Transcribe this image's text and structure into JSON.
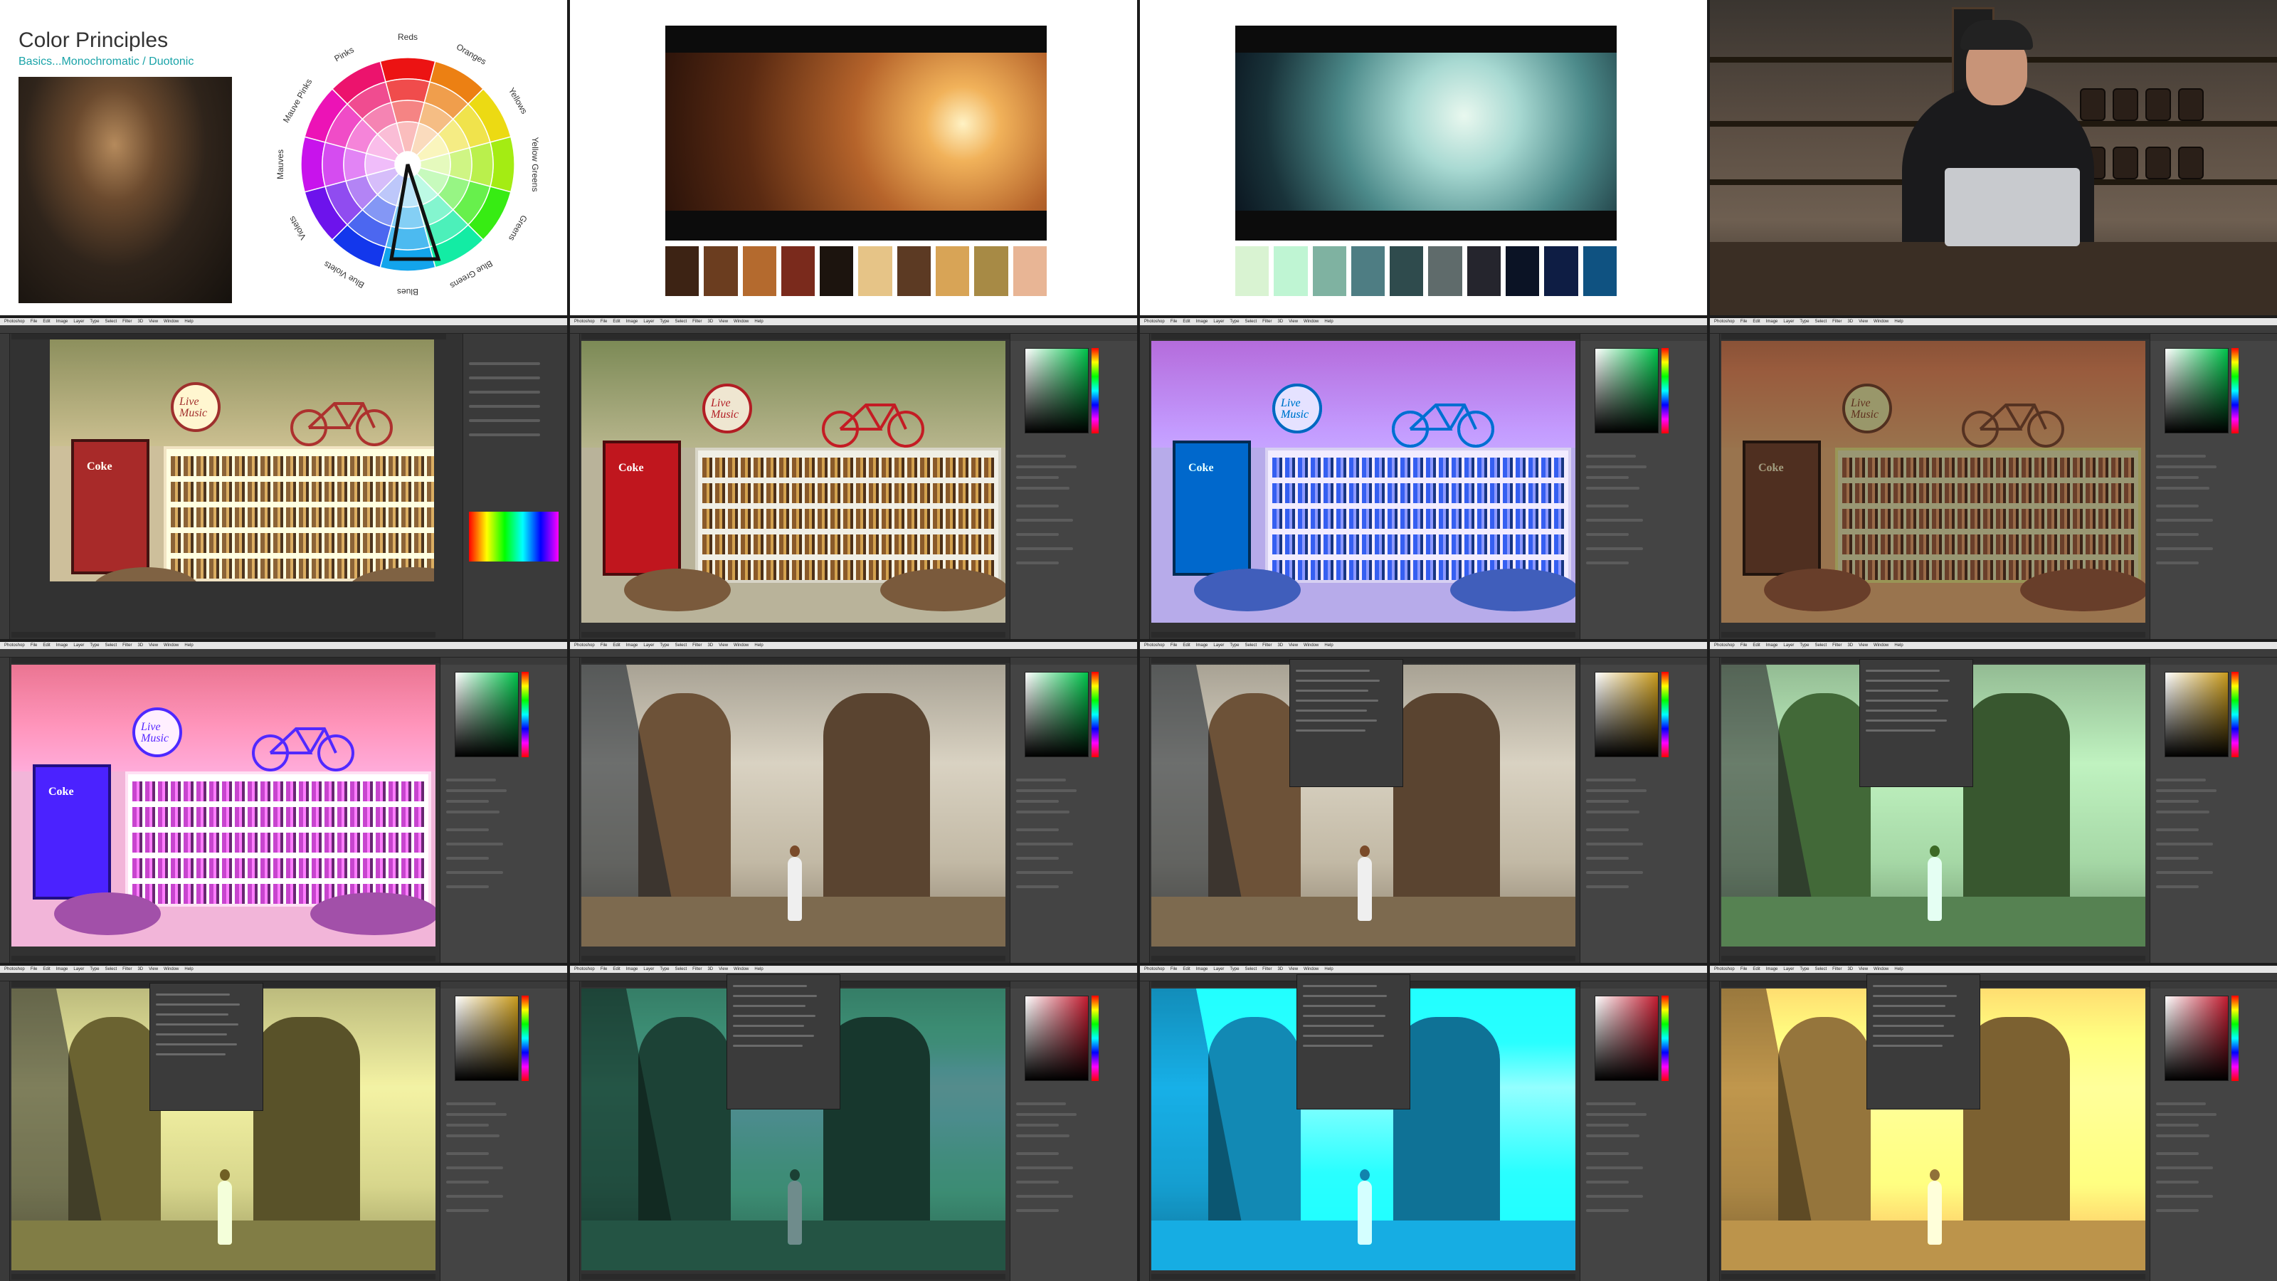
{
  "slide": {
    "title": "Color Principles",
    "subtitle": "Basics...Monochromatic / Duotonic",
    "wheel_labels": [
      "Reds",
      "Oranges",
      "Yellows",
      "Yellow Greens",
      "Greens",
      "Blue Greens",
      "Blues",
      "Blue Violets",
      "Violets",
      "Mauves",
      "Mauve Pinks",
      "Pinks"
    ]
  },
  "palettes": {
    "film1": [
      "#3d2314",
      "#6b3d1f",
      "#b46a2e",
      "#7a2a1c",
      "#1c140e",
      "#e6c487",
      "#5c3a23",
      "#d8a456",
      "#a78a45",
      "#e8b595"
    ],
    "film2": [
      "#d9f3d2",
      "#bff5d3",
      "#7fb2a1",
      "#4e7d83",
      "#2f4b4d",
      "#5f6b6b",
      "#25252d",
      "#0b1325",
      "#0e1d44",
      "#0f5281"
    ]
  },
  "photoshop": {
    "menu": [
      "Photoshop",
      "File",
      "Edit",
      "Image",
      "Layer",
      "Type",
      "Select",
      "Filter",
      "3D",
      "View",
      "Window",
      "Help"
    ],
    "brand_logo": "Coke",
    "sign_text": "Live Music"
  }
}
